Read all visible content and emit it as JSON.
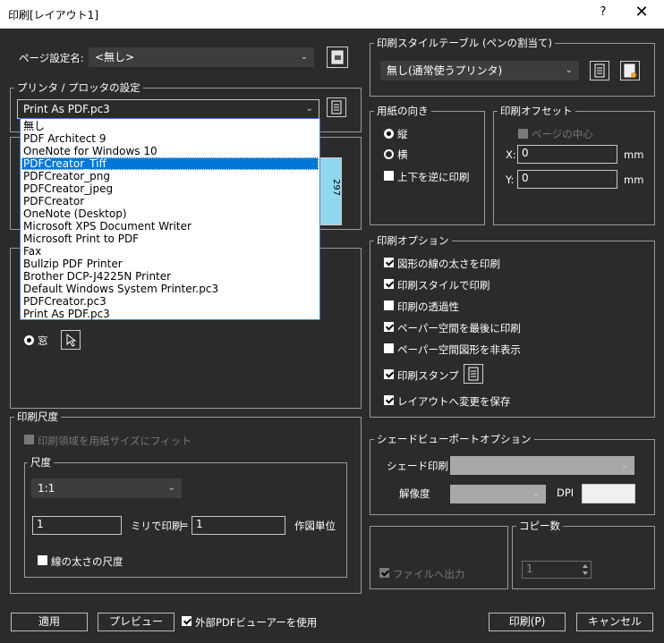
{
  "window": {
    "title": "印刷[レイアウト1]",
    "help": "?",
    "close": "✕"
  },
  "page_setup": {
    "label": "ページ設定名:",
    "value": "<無し>"
  },
  "printer": {
    "group_label": "プリンタ / プロッタの設定",
    "selected": "Print As PDF.pc3",
    "options": [
      "無し",
      "PDF Architect 9",
      "OneNote for Windows 10",
      "PDFCreator_Tiff",
      "PDFCreator_png",
      "PDFCreator_jpeg",
      "PDFCreator",
      "OneNote (Desktop)",
      "Microsoft XPS Document Writer",
      "Microsoft Print to PDF",
      "Fax",
      "Bullzip PDF Printer",
      "Brother DCP-J4225N Printer",
      "Default Windows System Printer.pc3",
      "PDFCreator.pc3",
      "Print As PDF.pc3"
    ],
    "highlighted": "PDFCreator_Tiff",
    "preview_dim": "297"
  },
  "print_area": {
    "window_label": "窓"
  },
  "scale": {
    "group_label": "印刷尺度",
    "fit_label": "印刷領域を用紙サイズにフィット",
    "sub_label": "尺度",
    "scale_value": "1:1",
    "mm_value": "1",
    "mm_label": "ミリで印刷",
    "equals": "=",
    "unit_value": "1",
    "unit_label": "作図単位",
    "lineweight_label": "線の太さの尺度"
  },
  "plot_style": {
    "group_label": "印刷スタイルテーブル (ペンの割当て)",
    "value": "無し(通常使うプリンタ)"
  },
  "orientation": {
    "group_label": "用紙の向き",
    "portrait": "縦",
    "landscape": "横",
    "upside_down": "上下を逆に印刷"
  },
  "offset": {
    "group_label": "印刷オフセット",
    "center_label": "ページの中心",
    "x_label": "X:",
    "x_value": "0",
    "y_label": "Y:",
    "y_value": "0",
    "unit": "mm"
  },
  "options": {
    "group_label": "印刷オプション",
    "items": [
      {
        "label": "図形の線の太さを印刷",
        "checked": true
      },
      {
        "label": "印刷スタイルで印刷",
        "checked": true
      },
      {
        "label": "印刷の透過性",
        "checked": false
      },
      {
        "label": "ペーパー空間を最後に印刷",
        "checked": true
      },
      {
        "label": "ペーパー空間図形を非表示",
        "checked": false
      },
      {
        "label": "印刷スタンプ",
        "checked": true
      },
      {
        "label": "レイアウトへ変更を保存",
        "checked": true
      }
    ]
  },
  "shaded": {
    "group_label": "シェードビューポートオプション",
    "shade_label": "シェード印刷",
    "quality_label": "解像度",
    "dpi_label": "DPI"
  },
  "file": {
    "label": "ファイルへ出力"
  },
  "copies": {
    "group_label": "コピー数",
    "value": "1"
  },
  "footer": {
    "apply": "適用",
    "preview": "プレビュー",
    "external_pdf": "外部PDFビューアーを使用",
    "print": "印刷(P)",
    "cancel": "キャンセル"
  }
}
